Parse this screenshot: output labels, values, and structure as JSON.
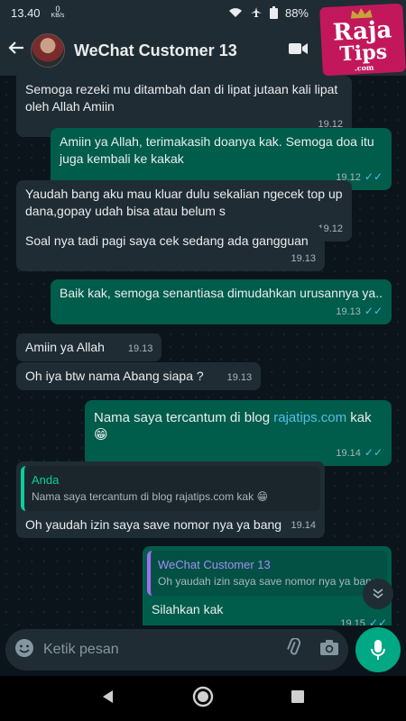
{
  "status_bar": {
    "time": "13.40",
    "net_speed_value": "0",
    "net_speed_unit": "KB/s",
    "battery": "88%"
  },
  "header": {
    "contact_name": "WeChat Customer 13"
  },
  "logo": {
    "line1": "Raja",
    "line2": "Tips",
    "line3": ".com"
  },
  "messages": [
    {
      "text": "Semoga rezeki mu ditambah dan di lipat jutaan kali lipat oleh Allah Amiin",
      "time": "19.12"
    },
    {
      "text": "Amiin ya Allah, terimakasih doanya kak. Semoga doa itu juga kembali ke kakak",
      "time": "19.12"
    },
    {
      "text": "Yaudah bang aku mau kluar dulu sekalian ngecek top up dana,gopay udah bisa atau belum s",
      "time": "19.12"
    },
    {
      "text": "Soal nya tadi pagi saya cek sedang ada gangguan",
      "time": "19.13"
    },
    {
      "text": "Baik kak, semoga senantiasa dimudahkan urusannya ya..",
      "time": "19.13"
    },
    {
      "text": "Amiin ya Allah",
      "time": "19.13"
    },
    {
      "text": "Oh iya btw nama Abang siapa ?",
      "time": "19.13"
    },
    {
      "text_before": "Nama saya tercantum di blog ",
      "link": "rajatips.com",
      "text_after": " kak 😁",
      "time": "19.14"
    },
    {
      "quote_author": "Anda",
      "quote_text": "Nama saya tercantum di blog rajatips.com kak 😁",
      "text": "Oh yaudah izin saya save nomor nya ya bang",
      "time": "19.14"
    },
    {
      "quote_author": "WeChat Customer 13",
      "quote_text": "Oh yaudah izin saya save nomor nya ya bang",
      "text": "Silahkan kak",
      "time": "19.15"
    }
  ],
  "composer": {
    "placeholder": "Ketik pesan"
  },
  "icons": {
    "back": "arrow-left-icon",
    "video": "video-call-icon",
    "emoji": "emoji-icon",
    "attach": "paperclip-icon",
    "camera": "camera-icon",
    "mic": "microphone-icon",
    "scroll": "chevron-double-down-icon"
  },
  "colors": {
    "incoming_bubble": "#202c33",
    "outgoing_bubble": "#005c4b",
    "link": "#53bdeb",
    "accent": "#00a884"
  }
}
